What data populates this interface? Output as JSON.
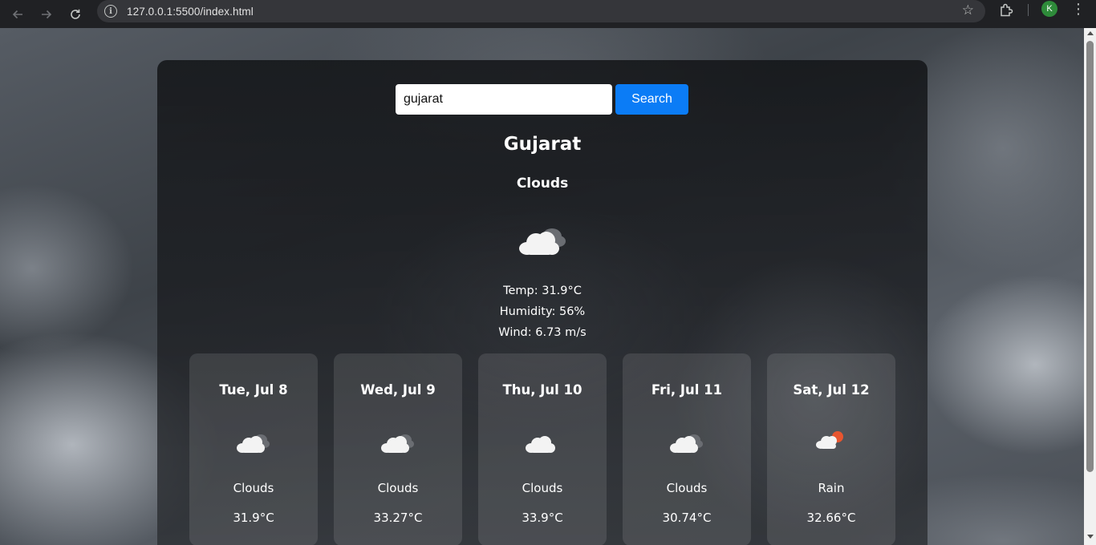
{
  "browser": {
    "url": "127.0.0.1:5500/index.html",
    "profile_initial": "K"
  },
  "search": {
    "value": "gujarat",
    "button_label": "Search"
  },
  "current": {
    "city": "Gujarat",
    "condition": "Clouds",
    "icon": "clouds-icon",
    "temp": "Temp: 31.9°C",
    "humidity": "Humidity: 56%",
    "wind": "Wind: 6.73 m/s"
  },
  "forecast": [
    {
      "date": "Tue, Jul 8",
      "icon": "clouds-icon",
      "condition": "Clouds",
      "temp": "31.9°C"
    },
    {
      "date": "Wed, Jul 9",
      "icon": "clouds-icon",
      "condition": "Clouds",
      "temp": "33.27°C"
    },
    {
      "date": "Thu, Jul 10",
      "icon": "clouds-icon",
      "condition": "Clouds",
      "temp": "33.9°C"
    },
    {
      "date": "Fri, Jul 11",
      "icon": "clouds-icon",
      "condition": "Clouds",
      "temp": "30.74°C"
    },
    {
      "date": "Sat, Jul 12",
      "icon": "rain-icon",
      "condition": "Rain",
      "temp": "32.66°C"
    }
  ],
  "colors": {
    "search_button": "#0b7cf6",
    "rain_sun": "#e8552f"
  }
}
